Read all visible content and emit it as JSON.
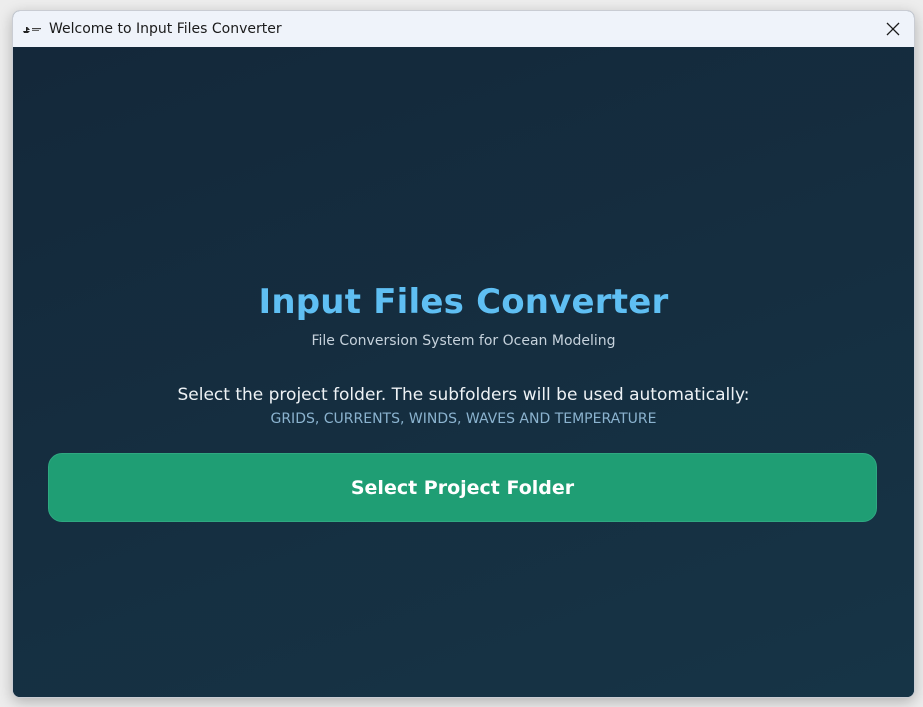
{
  "window": {
    "title": "Welcome to Input Files Converter",
    "logo_icon": "ship-logo-icon",
    "close_icon": "close-icon"
  },
  "main": {
    "title": "Input Files Converter",
    "subtitle": "File Conversion System for Ocean Modeling",
    "instruction": "Select the project folder. The subfolders will be used automatically:",
    "folders": "GRIDS, CURRENTS, WINDS, WAVES AND TEMPERATURE",
    "select_button_label": "Select Project Folder"
  },
  "colors": {
    "titlebar": "#eff3fa",
    "background": "#16303f",
    "title_accent": "#5fbff3",
    "folders_text": "#8bb3cf",
    "button": "#1f9e74"
  }
}
